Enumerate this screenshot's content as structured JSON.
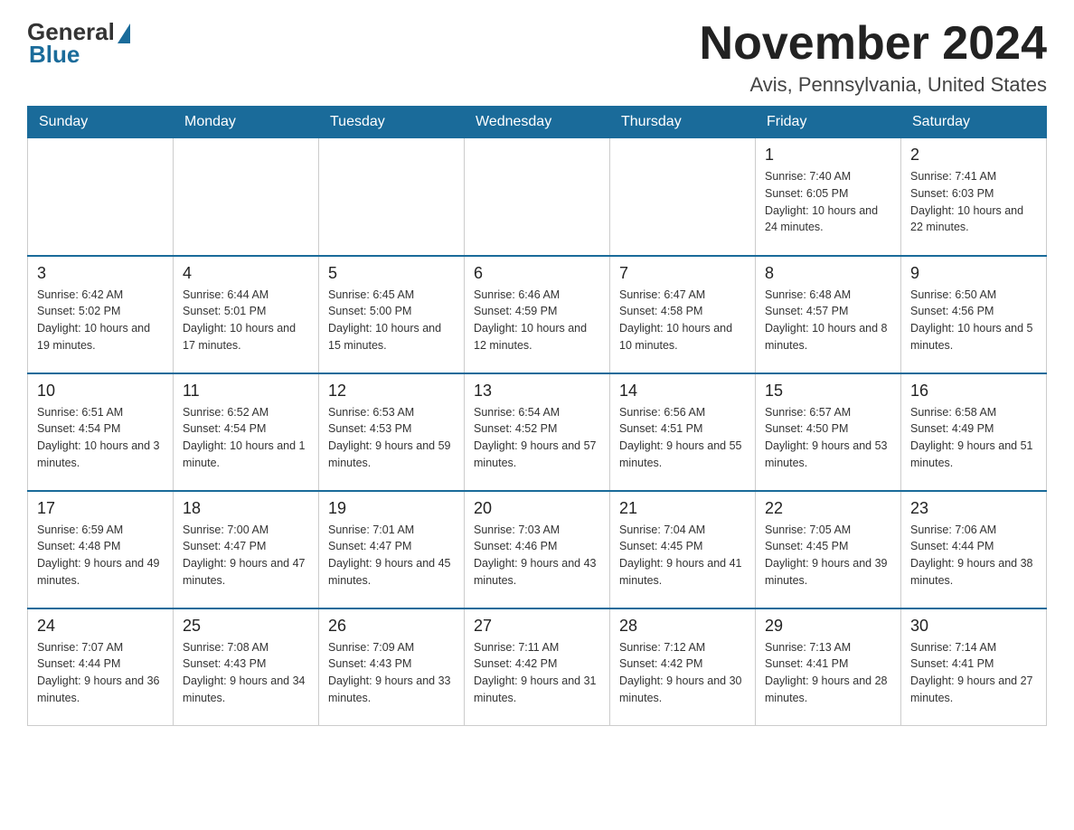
{
  "header": {
    "logo": {
      "general": "General",
      "blue": "Blue"
    },
    "title": "November 2024",
    "location": "Avis, Pennsylvania, United States"
  },
  "weekdays": [
    "Sunday",
    "Monday",
    "Tuesday",
    "Wednesday",
    "Thursday",
    "Friday",
    "Saturday"
  ],
  "weeks": [
    [
      {
        "day": "",
        "info": ""
      },
      {
        "day": "",
        "info": ""
      },
      {
        "day": "",
        "info": ""
      },
      {
        "day": "",
        "info": ""
      },
      {
        "day": "",
        "info": ""
      },
      {
        "day": "1",
        "info": "Sunrise: 7:40 AM\nSunset: 6:05 PM\nDaylight: 10 hours and 24 minutes."
      },
      {
        "day": "2",
        "info": "Sunrise: 7:41 AM\nSunset: 6:03 PM\nDaylight: 10 hours and 22 minutes."
      }
    ],
    [
      {
        "day": "3",
        "info": "Sunrise: 6:42 AM\nSunset: 5:02 PM\nDaylight: 10 hours and 19 minutes."
      },
      {
        "day": "4",
        "info": "Sunrise: 6:44 AM\nSunset: 5:01 PM\nDaylight: 10 hours and 17 minutes."
      },
      {
        "day": "5",
        "info": "Sunrise: 6:45 AM\nSunset: 5:00 PM\nDaylight: 10 hours and 15 minutes."
      },
      {
        "day": "6",
        "info": "Sunrise: 6:46 AM\nSunset: 4:59 PM\nDaylight: 10 hours and 12 minutes."
      },
      {
        "day": "7",
        "info": "Sunrise: 6:47 AM\nSunset: 4:58 PM\nDaylight: 10 hours and 10 minutes."
      },
      {
        "day": "8",
        "info": "Sunrise: 6:48 AM\nSunset: 4:57 PM\nDaylight: 10 hours and 8 minutes."
      },
      {
        "day": "9",
        "info": "Sunrise: 6:50 AM\nSunset: 4:56 PM\nDaylight: 10 hours and 5 minutes."
      }
    ],
    [
      {
        "day": "10",
        "info": "Sunrise: 6:51 AM\nSunset: 4:54 PM\nDaylight: 10 hours and 3 minutes."
      },
      {
        "day": "11",
        "info": "Sunrise: 6:52 AM\nSunset: 4:54 PM\nDaylight: 10 hours and 1 minute."
      },
      {
        "day": "12",
        "info": "Sunrise: 6:53 AM\nSunset: 4:53 PM\nDaylight: 9 hours and 59 minutes."
      },
      {
        "day": "13",
        "info": "Sunrise: 6:54 AM\nSunset: 4:52 PM\nDaylight: 9 hours and 57 minutes."
      },
      {
        "day": "14",
        "info": "Sunrise: 6:56 AM\nSunset: 4:51 PM\nDaylight: 9 hours and 55 minutes."
      },
      {
        "day": "15",
        "info": "Sunrise: 6:57 AM\nSunset: 4:50 PM\nDaylight: 9 hours and 53 minutes."
      },
      {
        "day": "16",
        "info": "Sunrise: 6:58 AM\nSunset: 4:49 PM\nDaylight: 9 hours and 51 minutes."
      }
    ],
    [
      {
        "day": "17",
        "info": "Sunrise: 6:59 AM\nSunset: 4:48 PM\nDaylight: 9 hours and 49 minutes."
      },
      {
        "day": "18",
        "info": "Sunrise: 7:00 AM\nSunset: 4:47 PM\nDaylight: 9 hours and 47 minutes."
      },
      {
        "day": "19",
        "info": "Sunrise: 7:01 AM\nSunset: 4:47 PM\nDaylight: 9 hours and 45 minutes."
      },
      {
        "day": "20",
        "info": "Sunrise: 7:03 AM\nSunset: 4:46 PM\nDaylight: 9 hours and 43 minutes."
      },
      {
        "day": "21",
        "info": "Sunrise: 7:04 AM\nSunset: 4:45 PM\nDaylight: 9 hours and 41 minutes."
      },
      {
        "day": "22",
        "info": "Sunrise: 7:05 AM\nSunset: 4:45 PM\nDaylight: 9 hours and 39 minutes."
      },
      {
        "day": "23",
        "info": "Sunrise: 7:06 AM\nSunset: 4:44 PM\nDaylight: 9 hours and 38 minutes."
      }
    ],
    [
      {
        "day": "24",
        "info": "Sunrise: 7:07 AM\nSunset: 4:44 PM\nDaylight: 9 hours and 36 minutes."
      },
      {
        "day": "25",
        "info": "Sunrise: 7:08 AM\nSunset: 4:43 PM\nDaylight: 9 hours and 34 minutes."
      },
      {
        "day": "26",
        "info": "Sunrise: 7:09 AM\nSunset: 4:43 PM\nDaylight: 9 hours and 33 minutes."
      },
      {
        "day": "27",
        "info": "Sunrise: 7:11 AM\nSunset: 4:42 PM\nDaylight: 9 hours and 31 minutes."
      },
      {
        "day": "28",
        "info": "Sunrise: 7:12 AM\nSunset: 4:42 PM\nDaylight: 9 hours and 30 minutes."
      },
      {
        "day": "29",
        "info": "Sunrise: 7:13 AM\nSunset: 4:41 PM\nDaylight: 9 hours and 28 minutes."
      },
      {
        "day": "30",
        "info": "Sunrise: 7:14 AM\nSunset: 4:41 PM\nDaylight: 9 hours and 27 minutes."
      }
    ]
  ]
}
